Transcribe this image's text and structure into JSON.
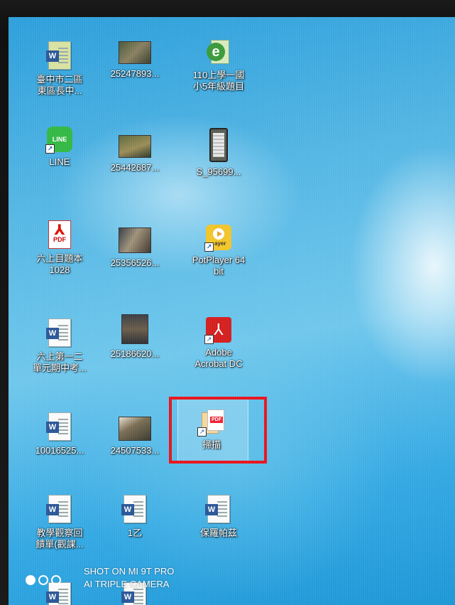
{
  "desktop": {
    "icons": [
      {
        "id": "doc1",
        "label": "臺中市二區\n東區長中...",
        "type": "word-doc"
      },
      {
        "id": "img1",
        "label": "25247893...",
        "type": "image"
      },
      {
        "id": "app-e",
        "label": "110上學一國\n小5年級題目",
        "type": "app-e"
      },
      {
        "id": "line",
        "label": "LINE",
        "type": "line-app",
        "icon_text": "LINE"
      },
      {
        "id": "img2",
        "label": "25442687...",
        "type": "image"
      },
      {
        "id": "img3",
        "label": "S_95699...",
        "type": "phone-image"
      },
      {
        "id": "pdf1",
        "label": "六上目題本\n1028",
        "type": "pdf",
        "icon_text": "PDF"
      },
      {
        "id": "img4",
        "label": "25356526...",
        "type": "image"
      },
      {
        "id": "potplayer",
        "label": "PotPlayer 64\nbit",
        "type": "potplayer",
        "icon_text": "ayer"
      },
      {
        "id": "doc2",
        "label": "六上第一二\n單元期中考...",
        "type": "word-doc"
      },
      {
        "id": "img5",
        "label": "25186620...",
        "type": "image"
      },
      {
        "id": "acrobat",
        "label": "Adobe\nAcrobat DC",
        "type": "acrobat"
      },
      {
        "id": "doc3",
        "label": "10016525...",
        "type": "word-doc"
      },
      {
        "id": "img6",
        "label": "24507533...",
        "type": "image"
      },
      {
        "id": "scan",
        "label": "掃描",
        "type": "pdf-scan",
        "icon_text": "PDF",
        "highlighted": true
      },
      {
        "id": "doc4",
        "label": "教學觀察回\n饋單(觀課...",
        "type": "word-doc"
      },
      {
        "id": "doc5",
        "label": "1乙",
        "type": "word-doc"
      },
      {
        "id": "doc6",
        "label": "保羅帕茲",
        "type": "word-doc"
      }
    ],
    "word_badge": "W",
    "shortcut_arrow": "↗"
  },
  "colors": {
    "highlight": "#e8141c",
    "desktop_blue": "#3aaae3"
  },
  "watermark": {
    "line1": "SHOT ON MI 9T PRO",
    "line2": "AI TRIPLE CAMERA"
  }
}
